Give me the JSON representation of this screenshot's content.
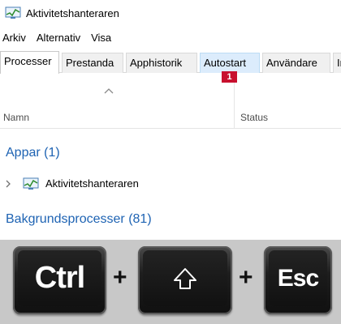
{
  "window": {
    "title": "Aktivitetshanteraren"
  },
  "menu": [
    "Arkiv",
    "Alternativ",
    "Visa"
  ],
  "tabs": [
    "Processer",
    "Prestanda",
    "Apphistorik",
    "Autostart",
    "Användare",
    "Information"
  ],
  "badge": "1",
  "columns": {
    "name": "Namn",
    "status": "Status"
  },
  "groups": {
    "apps": "Appar (1)",
    "background": "Bakgrundsprocesser (81)"
  },
  "process": {
    "name": "Aktivitetshanteraren"
  },
  "keys": {
    "ctrl": "Ctrl",
    "plus1": "+",
    "plus2": "+",
    "esc": "Esc",
    "shift_icon": "shift-icon"
  },
  "colors": {
    "group_title": "#1e63b3",
    "badge": "#c8102e",
    "tab_hover": "#dcecfc"
  }
}
